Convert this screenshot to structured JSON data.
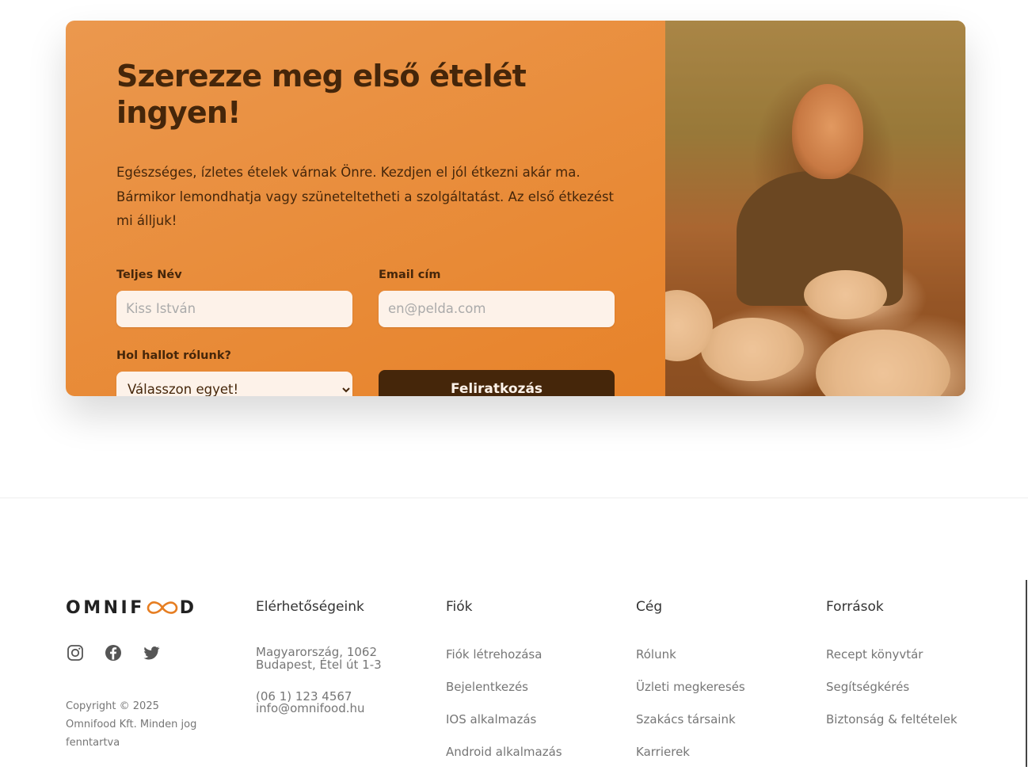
{
  "cta": {
    "title": "Szerezze meg első ételét ingyen!",
    "description": "Egészséges, ízletes ételek várnak Önre. Kezdjen el jól étkezni akár ma. Bármikor lemondhatja vagy szüneteltetheti a szolgáltatást. Az első étkezést mi álljuk!",
    "name_label": "Teljes Név",
    "name_placeholder": "Kiss István",
    "email_label": "Email cím",
    "email_placeholder": "en@pelda.com",
    "source_label": "Hol hallot rólunk?",
    "source_selected": "Válasszon egyet!",
    "submit_label": "Feliratkozás"
  },
  "footer": {
    "logo_left": "OMNIF",
    "logo_right": "D",
    "copyright": "Copyright © 2025 Omnifood Kft. Minden jog fenntartva",
    "contact": {
      "heading": "Elérhetőségeink",
      "address_line1": "Magyarország, 1062",
      "address_line2": "Budapest, Étel út 1-3",
      "phone": "(06 1) 123 4567",
      "email": "info@omnifood.hu"
    },
    "account": {
      "heading": "Fiók",
      "links": [
        "Fiók létrehozása",
        "Bejelentkezés",
        "IOS alkalmazás",
        "Android alkalmazás"
      ]
    },
    "company": {
      "heading": "Cég",
      "links": [
        "Rólunk",
        "Üzleti megkeresés",
        "Szakács társaink",
        "Karrierek"
      ]
    },
    "resources": {
      "heading": "Források",
      "links": [
        "Recept könyvtár",
        "Segítségkérés",
        "Biztonság & feltételek"
      ]
    }
  },
  "colors": {
    "brand": "#e67e22",
    "brand_dark": "#45260a",
    "input_bg": "#fdf2e9"
  },
  "icons": [
    "instagram-icon",
    "facebook-icon",
    "twitter-icon",
    "infinity-logo-icon"
  ]
}
